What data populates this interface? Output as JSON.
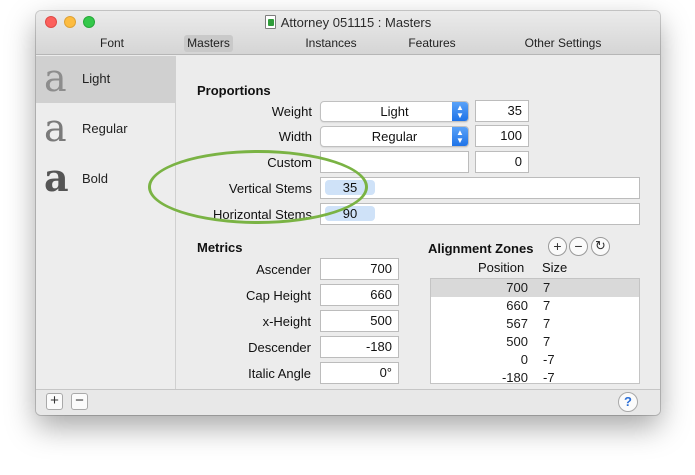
{
  "window": {
    "title": "Attorney 051115 : Masters",
    "icon": "glyphs-document-icon"
  },
  "tabs": [
    {
      "label": "Font"
    },
    {
      "label": "Masters"
    },
    {
      "label": "Instances"
    },
    {
      "label": "Features"
    },
    {
      "label": "Other Settings"
    }
  ],
  "sidebar": {
    "masters": [
      {
        "glyph": "a",
        "name": "Light"
      },
      {
        "glyph": "a",
        "name": "Regular"
      },
      {
        "glyph": "a",
        "name": "Bold"
      }
    ]
  },
  "proportions": {
    "heading": "Proportions",
    "weight_label": "Weight",
    "weight_value": "Light",
    "weight_number": "35",
    "width_label": "Width",
    "width_value": "Regular",
    "width_number": "100",
    "custom_label": "Custom",
    "custom_value": "",
    "custom_number": "0",
    "vertical_stems_label": "Vertical Stems",
    "vertical_stems_value": "35",
    "horizontal_stems_label": "Horizontal Stems",
    "horizontal_stems_value": "90"
  },
  "metrics": {
    "heading": "Metrics",
    "ascender_label": "Ascender",
    "ascender_value": "700",
    "cap_height_label": "Cap Height",
    "cap_height_value": "660",
    "x_height_label": "x-Height",
    "x_height_value": "500",
    "descender_label": "Descender",
    "descender_value": "-180",
    "italic_angle_label": "Italic Angle",
    "italic_angle_value": "0°"
  },
  "alignment_zones": {
    "heading": "Alignment Zones",
    "position_header": "Position",
    "size_header": "Size",
    "rows": [
      {
        "position": "700",
        "size": "7"
      },
      {
        "position": "660",
        "size": "7"
      },
      {
        "position": "567",
        "size": "7"
      },
      {
        "position": "500",
        "size": "7"
      },
      {
        "position": "0",
        "size": "-7"
      },
      {
        "position": "-180",
        "size": "-7"
      }
    ]
  },
  "colors": {
    "highlight_ellipse": "#7ab344",
    "token_fill": "#cfe2f8",
    "popup_accent": "#1e73e8"
  }
}
